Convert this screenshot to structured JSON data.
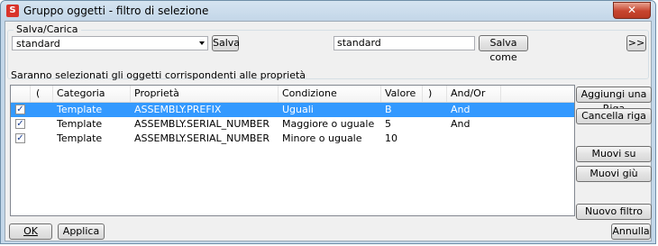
{
  "window": {
    "title": "Gruppo oggetti  - filtro di selezione",
    "close_label": "✕"
  },
  "save_load": {
    "group_label": "Salva/Carica",
    "combo_value": "standard",
    "save_label": "Salva",
    "name_value": "standard",
    "save_as_label": "Salva come",
    "expand_label": ">>"
  },
  "filter": {
    "description": "Saranno selezionati gli oggetti corrispondenti alle proprietà",
    "columns": [
      "(",
      "Categoria",
      "Proprietà",
      "Condizione",
      "Valore",
      ")",
      "And/Or"
    ],
    "rows": [
      {
        "checked": "✓",
        "open": "",
        "category": "Template",
        "property": "ASSEMBLY.PREFIX",
        "condition": "Uguali",
        "value": "B",
        "close": "",
        "andor": "And",
        "selected": true
      },
      {
        "checked": "✓",
        "open": "",
        "category": "Template",
        "property": "ASSEMBLY.SERIAL_NUMBER",
        "condition": "Maggiore o uguale",
        "value": "5",
        "close": "",
        "andor": "And",
        "selected": false
      },
      {
        "checked": "✓",
        "open": "",
        "category": "Template",
        "property": "ASSEMBLY.SERIAL_NUMBER",
        "condition": "Minore o uguale",
        "value": "10",
        "close": "",
        "andor": "",
        "selected": false
      }
    ]
  },
  "side_buttons": {
    "add_row": "Aggiungi una Riga",
    "delete_row": "Cancella riga",
    "move_up": "Muovi su",
    "move_down": "Muovi giù",
    "new_filter": "Nuovo filtro"
  },
  "footer": {
    "ok": "OK",
    "apply": "Applica",
    "cancel": "Annulla"
  },
  "colors": {
    "selection": "#3399ff",
    "frame": "#c3d7e9"
  }
}
